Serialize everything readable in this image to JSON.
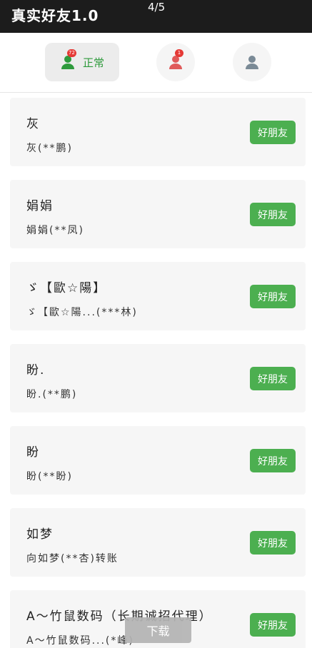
{
  "app": {
    "title": "真实好友1.0",
    "page_indicator": "4/5"
  },
  "tabs": [
    {
      "label": "正常",
      "badge": "72",
      "color": "#2e9a3c"
    },
    {
      "label": "",
      "badge": "1",
      "color": "#e05a5a"
    },
    {
      "label": "",
      "badge": "",
      "color": "#7a8a96"
    }
  ],
  "friends": [
    {
      "name": "灰",
      "sub": "灰(**鹏)",
      "button": "好朋友"
    },
    {
      "name": "娟娟",
      "sub": "娟娟(**凤)",
      "button": "好朋友"
    },
    {
      "name": "ゞ【歐☆陽】",
      "sub": "ゞ【歐☆陽...(***林)",
      "button": "好朋友"
    },
    {
      "name": "盼.",
      "sub": "盼.(**鹏)",
      "button": "好朋友"
    },
    {
      "name": "盼",
      "sub": "盼(**盼)",
      "button": "好朋友"
    },
    {
      "name": "如梦",
      "sub": "向如梦(**杏)转账",
      "button": "好朋友"
    },
    {
      "name": "A～竹鼠数码（长期诚招代理）",
      "sub": "A～竹鼠数码...(*峰)",
      "button": "好朋友"
    }
  ],
  "download": {
    "label": "下载"
  }
}
